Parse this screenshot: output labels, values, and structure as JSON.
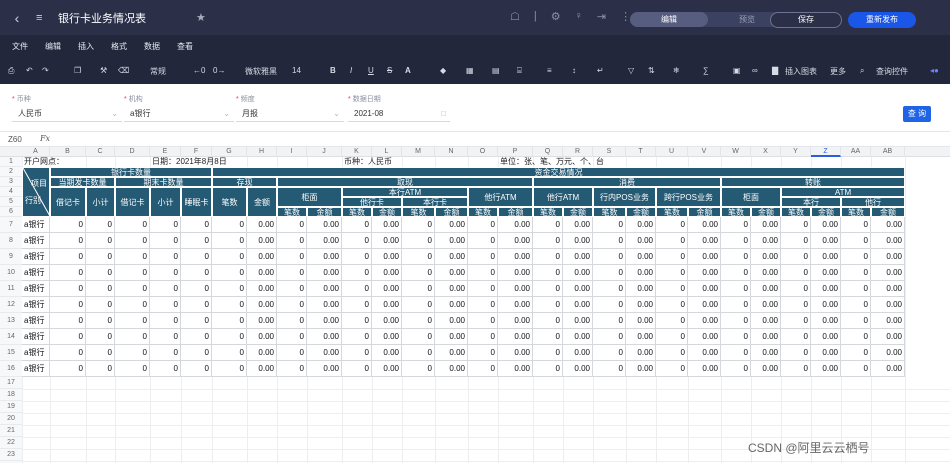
{
  "titlebar": {
    "title": "银行卡业务情况表",
    "tabs": [
      "编辑",
      "预览"
    ],
    "active_tab": 0,
    "save_label": "保存",
    "publish_label": "重新发布"
  },
  "menu": [
    "文件",
    "编辑",
    "插入",
    "格式",
    "数据",
    "查看"
  ],
  "toolbar": {
    "format": "常规",
    "font": "微软雅黑",
    "size": "14",
    "insert_chart": "插入图表",
    "more": "更多",
    "query_control": "查询控件"
  },
  "filters": [
    {
      "label": "币种",
      "value": "人民币"
    },
    {
      "label": "机构",
      "value": "a银行"
    },
    {
      "label": "频度",
      "value": "月报"
    },
    {
      "label": "数据日期",
      "value": "2021-08"
    }
  ],
  "query_label": "查 询",
  "formula": {
    "cell": "Z60",
    "fx": "Fx"
  },
  "columns": [
    "A",
    "B",
    "C",
    "D",
    "E",
    "F",
    "G",
    "H",
    "I",
    "J",
    "K",
    "L",
    "M",
    "N",
    "O",
    "P",
    "Q",
    "R",
    "S",
    "T",
    "U",
    "V",
    "W",
    "X",
    "Y",
    "Z",
    "AA",
    "AB"
  ],
  "selected_column": "Z",
  "sheet": {
    "open_branch": "开户网点：",
    "date": "日期：2021年8月8日",
    "currency": "币种：人民币",
    "unit": "单位：张、笔、万元、个、台",
    "h_project": "项目",
    "h_type": "行别",
    "h_card_qty": "银行卡数量",
    "h_fund_tx": "资金交易情况",
    "h_new": "当期发卡数量",
    "h_end": "期末卡数量",
    "h_deposit": "存现",
    "h_withdraw": "取现",
    "h_consume": "消费",
    "h_transfer": "转账",
    "h_debit": "借记卡",
    "h_subtotal": "小计",
    "h_dormant": "睡眠卡",
    "h_count": "笔数",
    "h_amount": "金额",
    "h_counter": "柜面",
    "h_own_atm": "本行ATM",
    "h_other_card": "他行卡",
    "h_own_card": "本行卡",
    "h_other_atm": "他行ATM",
    "h_in_pos": "行内POS业务",
    "h_cross_pos": "跨行POS业务",
    "h_atm": "ATM",
    "h_own_bank": "本行",
    "h_other_bank": "他行"
  },
  "rows": [
    [
      "a银行",
      "0",
      "0",
      "0",
      "0",
      "0",
      "0",
      "0.00",
      "0",
      "0.00",
      "0",
      "0.00",
      "0",
      "0.00",
      "0",
      "0.00",
      "0",
      "0.00",
      "0",
      "0.00",
      "0",
      "0.00",
      "0",
      "0.00",
      "0",
      "0.00",
      "0",
      "0.00"
    ],
    [
      "a银行",
      "0",
      "0",
      "0",
      "0",
      "0",
      "0",
      "0.00",
      "0",
      "0.00",
      "0",
      "0.00",
      "0",
      "0.00",
      "0",
      "0.00",
      "0",
      "0.00",
      "0",
      "0.00",
      "0",
      "0.00",
      "0",
      "0.00",
      "0",
      "0.00",
      "0",
      "0.00"
    ],
    [
      "a银行",
      "0",
      "0",
      "0",
      "0",
      "0",
      "0",
      "0.00",
      "0",
      "0.00",
      "0",
      "0.00",
      "0",
      "0.00",
      "0",
      "0.00",
      "0",
      "0.00",
      "0",
      "0.00",
      "0",
      "0.00",
      "0",
      "0.00",
      "0",
      "0.00",
      "0",
      "0.00"
    ],
    [
      "a银行",
      "0",
      "0",
      "0",
      "0",
      "0",
      "0",
      "0.00",
      "0",
      "0.00",
      "0",
      "0.00",
      "0",
      "0.00",
      "0",
      "0.00",
      "0",
      "0.00",
      "0",
      "0.00",
      "0",
      "0.00",
      "0",
      "0.00",
      "0",
      "0.00",
      "0",
      "0.00"
    ],
    [
      "a银行",
      "0",
      "0",
      "0",
      "0",
      "0",
      "0",
      "0.00",
      "0",
      "0.00",
      "0",
      "0.00",
      "0",
      "0.00",
      "0",
      "0.00",
      "0",
      "0.00",
      "0",
      "0.00",
      "0",
      "0.00",
      "0",
      "0.00",
      "0",
      "0.00",
      "0",
      "0.00"
    ],
    [
      "a银行",
      "0",
      "0",
      "0",
      "0",
      "0",
      "0",
      "0.00",
      "0",
      "0.00",
      "0",
      "0.00",
      "0",
      "0.00",
      "0",
      "0.00",
      "0",
      "0.00",
      "0",
      "0.00",
      "0",
      "0.00",
      "0",
      "0.00",
      "0",
      "0.00",
      "0",
      "0.00"
    ],
    [
      "a银行",
      "0",
      "0",
      "0",
      "0",
      "0",
      "0",
      "0.00",
      "0",
      "0.00",
      "0",
      "0.00",
      "0",
      "0.00",
      "0",
      "0.00",
      "0",
      "0.00",
      "0",
      "0.00",
      "0",
      "0.00",
      "0",
      "0.00",
      "0",
      "0.00",
      "0",
      "0.00"
    ],
    [
      "a银行",
      "0",
      "0",
      "0",
      "0",
      "0",
      "0",
      "0.00",
      "0",
      "0.00",
      "0",
      "0.00",
      "0",
      "0.00",
      "0",
      "0.00",
      "0",
      "0.00",
      "0",
      "0.00",
      "0",
      "0.00",
      "0",
      "0.00",
      "0",
      "0.00",
      "0",
      "0.00"
    ],
    [
      "a银行",
      "0",
      "0",
      "0",
      "0",
      "0",
      "0",
      "0.00",
      "0",
      "0.00",
      "0",
      "0.00",
      "0",
      "0.00",
      "0",
      "0.00",
      "0",
      "0.00",
      "0",
      "0.00",
      "0",
      "0.00",
      "0",
      "0.00",
      "0",
      "0.00",
      "0",
      "0.00"
    ],
    [
      "a银行",
      "0",
      "0",
      "0",
      "0",
      "0",
      "0",
      "0.00",
      "0",
      "0.00",
      "0",
      "0.00",
      "0",
      "0.00",
      "0",
      "0.00",
      "0",
      "0.00",
      "0",
      "0.00",
      "0",
      "0.00",
      "0",
      "0.00",
      "0",
      "0.00",
      "0",
      "0.00"
    ]
  ],
  "watermark": "CSDN @阿里云云栖号",
  "colors": {
    "header_bg": "#255a74",
    "titlebar_bg": "#2b3048",
    "toolbar_bg": "#22273b",
    "accent": "#1a56e8"
  }
}
